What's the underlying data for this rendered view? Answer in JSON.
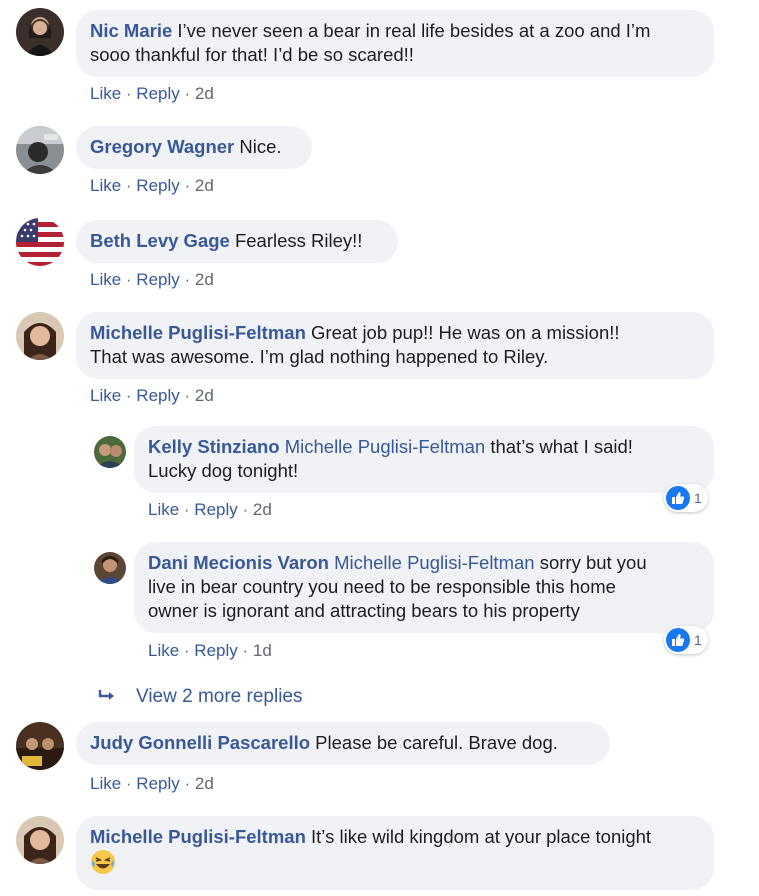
{
  "comments": [
    {
      "author": "Nic Marie",
      "text_line1": "I’ve never seen a bear in real life besides at a zoo and I’m",
      "text_line2": "sooo thankful for that! I’d be so scared!!",
      "like": "Like",
      "reply": "Reply",
      "time": "2d"
    },
    {
      "author": "Gregory Wagner",
      "text": "Nice.",
      "like": "Like",
      "reply": "Reply",
      "time": "2d"
    },
    {
      "author": "Beth Levy Gage",
      "text": "Fearless Riley!!",
      "like": "Like",
      "reply": "Reply",
      "time": "2d"
    },
    {
      "author": "Michelle Puglisi-Feltman",
      "text_line1": "Great job pup!! He was on a mission!!",
      "text_line2": "That was awesome. I’m glad nothing happened to Riley.",
      "like": "Like",
      "reply": "Reply",
      "time": "2d"
    },
    {
      "author": "Judy Gonnelli Pascarello",
      "text": "Please be careful. Brave dog.",
      "like": "Like",
      "reply": "Reply",
      "time": "2d"
    },
    {
      "author": "Michelle Puglisi-Feltman",
      "text": "It’s like wild kingdom at your place tonight"
    }
  ],
  "replies": [
    {
      "author": "Kelly Stinziano",
      "mention": "Michelle Puglisi-Feltman",
      "text_line1": "that’s what I said!",
      "text_line2": "Lucky dog tonight!",
      "like": "Like",
      "reply": "Reply",
      "time": "2d",
      "reaction_count": "1"
    },
    {
      "author": "Dani Mecionis Varon",
      "mention": "Michelle Puglisi-Feltman",
      "text_line1": "sorry but you",
      "text_line2": "live in bear country you need to be responsible this home",
      "text_line3": "owner is ignorant and attracting bears to his property",
      "like": "Like",
      "reply": "Reply",
      "time": "1d",
      "reaction_count": "1"
    }
  ],
  "more_replies": "View 2 more replies",
  "colors": {
    "link": "#385898",
    "bubble": "#f0f2f5",
    "meta": "#606770",
    "like_blue": "#1877f2"
  }
}
